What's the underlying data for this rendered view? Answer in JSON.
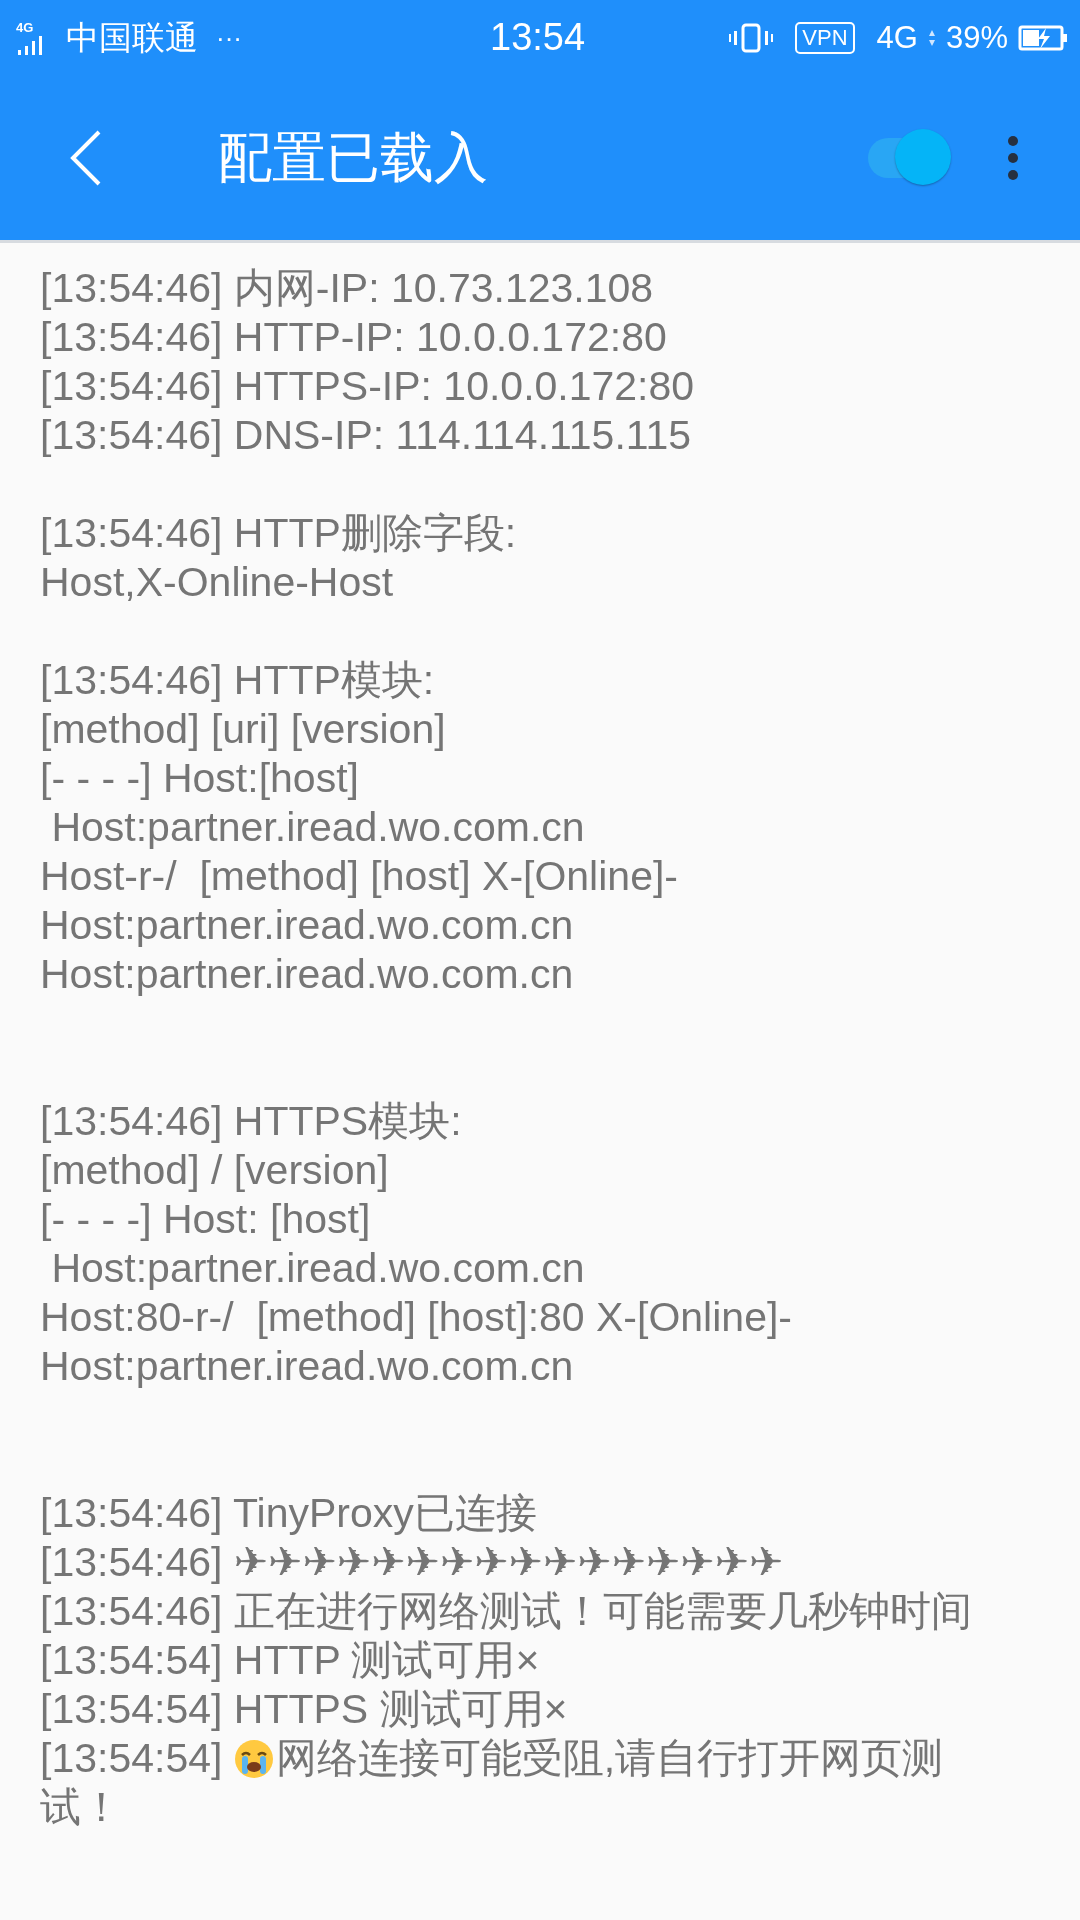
{
  "status_bar": {
    "network": "4G",
    "carrier": "中国联通",
    "more": "···",
    "time": "13:54",
    "vpn": "VPN",
    "data": "4G",
    "battery": "39%"
  },
  "toolbar": {
    "title": "配置已载入",
    "switch_on": true
  },
  "log": [
    {
      "kind": "short-gap",
      "lines": [
        {
          "kind": "plain",
          "text": "[13:54:46] 内网-IP: 10.73.123.108"
        },
        {
          "kind": "plain",
          "text": "[13:54:46] HTTP-IP: 10.0.0.172:80"
        },
        {
          "kind": "plain",
          "text": "[13:54:46] HTTPS-IP: 10.0.0.172:80"
        },
        {
          "kind": "plain",
          "text": "[13:54:46] DNS-IP: 114.114.115.115"
        }
      ]
    },
    {
      "kind": "short-gap",
      "lines": [
        {
          "kind": "plain",
          "text": "[13:54:46] HTTP删除字段:"
        },
        {
          "kind": "plain",
          "text": "Host,X-Online-Host"
        }
      ]
    },
    {
      "kind": "long-gap",
      "lines": [
        {
          "kind": "plain",
          "text": "[13:54:46] HTTP模块:"
        },
        {
          "kind": "plain",
          "text": "[method] [uri] [version]"
        },
        {
          "kind": "plain",
          "text": "[- - - -] Host:[host]"
        },
        {
          "kind": "plain",
          "text": " Host:partner.iread.wo.com.cn"
        },
        {
          "kind": "plain",
          "text": "Host-r-/  [method] [host] X-[Online]-"
        },
        {
          "kind": "plain",
          "text": "Host:partner.iread.wo.com.cn"
        },
        {
          "kind": "plain",
          "text": "Host:partner.iread.wo.com.cn"
        }
      ]
    },
    {
      "kind": "long-gap",
      "lines": [
        {
          "kind": "plain",
          "text": "[13:54:46] HTTPS模块:"
        },
        {
          "kind": "plain",
          "text": "[method] / [version]"
        },
        {
          "kind": "plain",
          "text": "[- - - -] Host: [host]"
        },
        {
          "kind": "plain",
          "text": " Host:partner.iread.wo.com.cn"
        },
        {
          "kind": "plain",
          "text": "Host:80-r-/  [method] [host]:80 X-[Online]-"
        },
        {
          "kind": "plain",
          "text": "Host:partner.iread.wo.com.cn"
        }
      ]
    },
    {
      "kind": "short-gap",
      "lines": [
        {
          "kind": "plain",
          "text": "[13:54:46] TinyProxy已连接"
        },
        {
          "kind": "plain",
          "text": "[13:54:46] ✈✈✈✈✈✈✈✈✈✈✈✈✈✈✈✈"
        },
        {
          "kind": "plain",
          "text": "[13:54:46] 正在进行网络测试！可能需要几秒钟时间"
        },
        {
          "kind": "plain",
          "text": "[13:54:54] HTTP 测试可用×"
        },
        {
          "kind": "plain",
          "text": "[13:54:54] HTTPS 测试可用×"
        },
        {
          "kind": "emoji",
          "time": "[13:54:54]",
          "text": "网络连接可能受阻,请自行打开网页测"
        },
        {
          "kind": "plain",
          "text": "试！"
        }
      ]
    }
  ]
}
